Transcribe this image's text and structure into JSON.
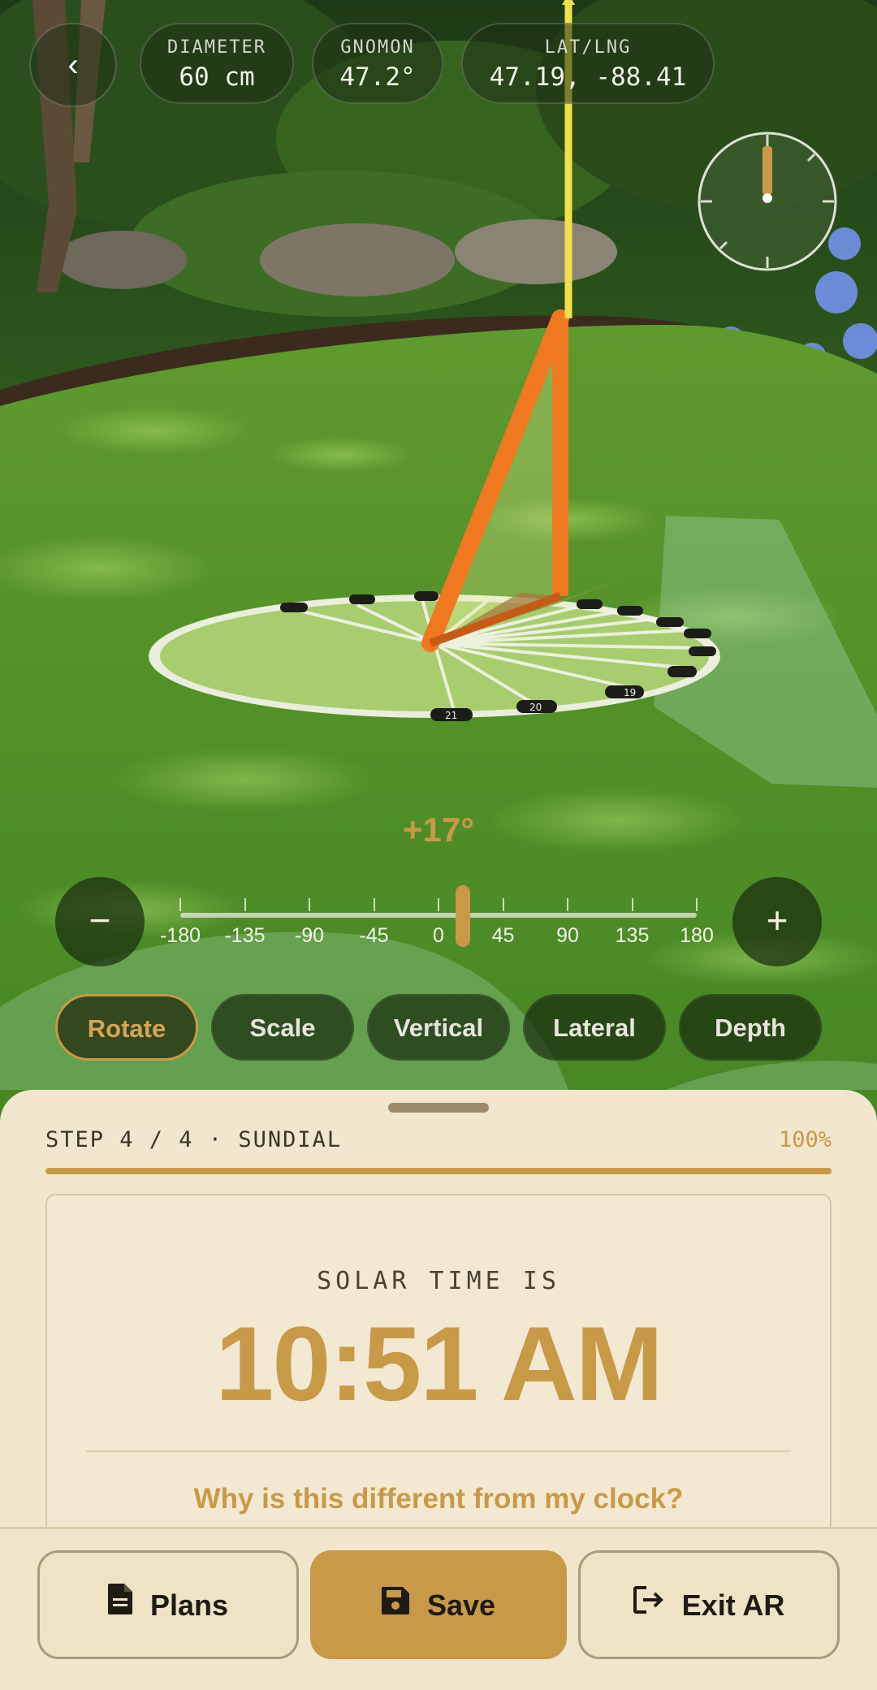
{
  "hud": {
    "back_icon": "chevron-left-icon",
    "diameter": {
      "label": "DIAMETER",
      "value": "60 cm"
    },
    "gnomon": {
      "label": "GNOMON",
      "value": "47.2°"
    },
    "latlng": {
      "label": "LAT/LNG",
      "value": "47.19, -88.41"
    },
    "compass_icon": "compass-icon"
  },
  "sundial": {
    "hour_labels": [
      "21",
      "20",
      "19"
    ]
  },
  "adjust": {
    "angle_readout": "+17°",
    "angle_value": 17,
    "minus_label": "−",
    "plus_label": "+",
    "ticks": [
      "-180",
      "-135",
      "-90",
      "-45",
      "0",
      "45",
      "90",
      "135",
      "180"
    ],
    "range": [
      -180,
      180
    ]
  },
  "modes": [
    {
      "label": "Rotate",
      "active": true
    },
    {
      "label": "Scale",
      "active": false
    },
    {
      "label": "Vertical",
      "active": false
    },
    {
      "label": "Lateral",
      "active": false
    },
    {
      "label": "Depth",
      "active": false
    }
  ],
  "sheet": {
    "step_label": "STEP 4 / 4 · SUNDIAL",
    "percent_label": "100%",
    "progress": 1.0,
    "caption": "SOLAR TIME IS",
    "solar_time": "10:51 AM",
    "why_link": "Why is this different from my clock?"
  },
  "actions": {
    "plans": {
      "label": "Plans",
      "icon": "document-icon"
    },
    "save": {
      "label": "Save",
      "icon": "floppy-disk-icon"
    },
    "exit": {
      "label": "Exit AR",
      "icon": "exit-icon"
    }
  },
  "colors": {
    "accent": "#c89a48",
    "gnomon": "#f07820",
    "sun_ray": "#f2e04a",
    "sheet_bg": "#f1e7cf"
  }
}
